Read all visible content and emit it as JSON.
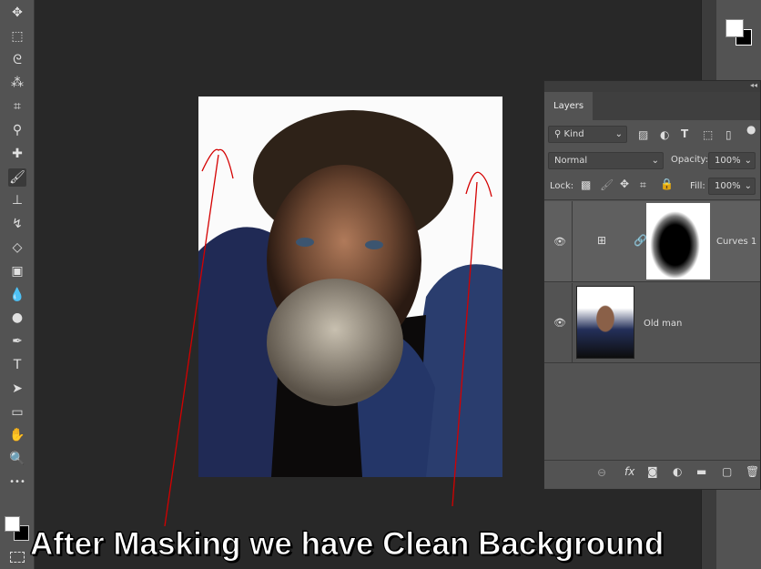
{
  "toolbar": {
    "tools": [
      {
        "name": "move-tool",
        "glyph": "✥"
      },
      {
        "name": "marquee-tool",
        "glyph": "⬚"
      },
      {
        "name": "lasso-tool",
        "glyph": "ᘓ"
      },
      {
        "name": "magic-wand-tool",
        "glyph": "⁂"
      },
      {
        "name": "crop-tool",
        "glyph": "⌗"
      },
      {
        "name": "eyedropper-tool",
        "glyph": "⚲"
      },
      {
        "name": "healing-brush-tool",
        "glyph": "✚"
      },
      {
        "name": "brush-tool",
        "glyph": "🖌"
      },
      {
        "name": "clone-stamp-tool",
        "glyph": "⊥"
      },
      {
        "name": "history-brush-tool",
        "glyph": "↯"
      },
      {
        "name": "eraser-tool",
        "glyph": "◇"
      },
      {
        "name": "gradient-tool",
        "glyph": "▣"
      },
      {
        "name": "blur-tool",
        "glyph": "💧"
      },
      {
        "name": "dodge-tool",
        "glyph": "●"
      },
      {
        "name": "pen-tool",
        "glyph": "✒"
      },
      {
        "name": "type-tool",
        "glyph": "T"
      },
      {
        "name": "path-selection-tool",
        "glyph": "➤"
      },
      {
        "name": "rectangle-tool",
        "glyph": "▭"
      },
      {
        "name": "hand-tool",
        "glyph": "✋"
      },
      {
        "name": "zoom-tool",
        "glyph": "🔍"
      },
      {
        "name": "more-tools",
        "glyph": "•••"
      }
    ],
    "active": 7
  },
  "layers_panel": {
    "tab": "Layers",
    "filter_kind": "Kind",
    "blend_mode": "Normal",
    "opacity_label": "Opacity:",
    "opacity": "100%",
    "lock_label": "Lock:",
    "fill_label": "Fill:",
    "fill": "100%",
    "layers": [
      {
        "name": "Curves 1",
        "selected": true
      },
      {
        "name": "Old man",
        "selected": false
      }
    ]
  },
  "caption": "After Masking we have Clean Background",
  "colors": {
    "foreground": "#ffffff",
    "background": "#000000",
    "annotation": "#d40000"
  }
}
